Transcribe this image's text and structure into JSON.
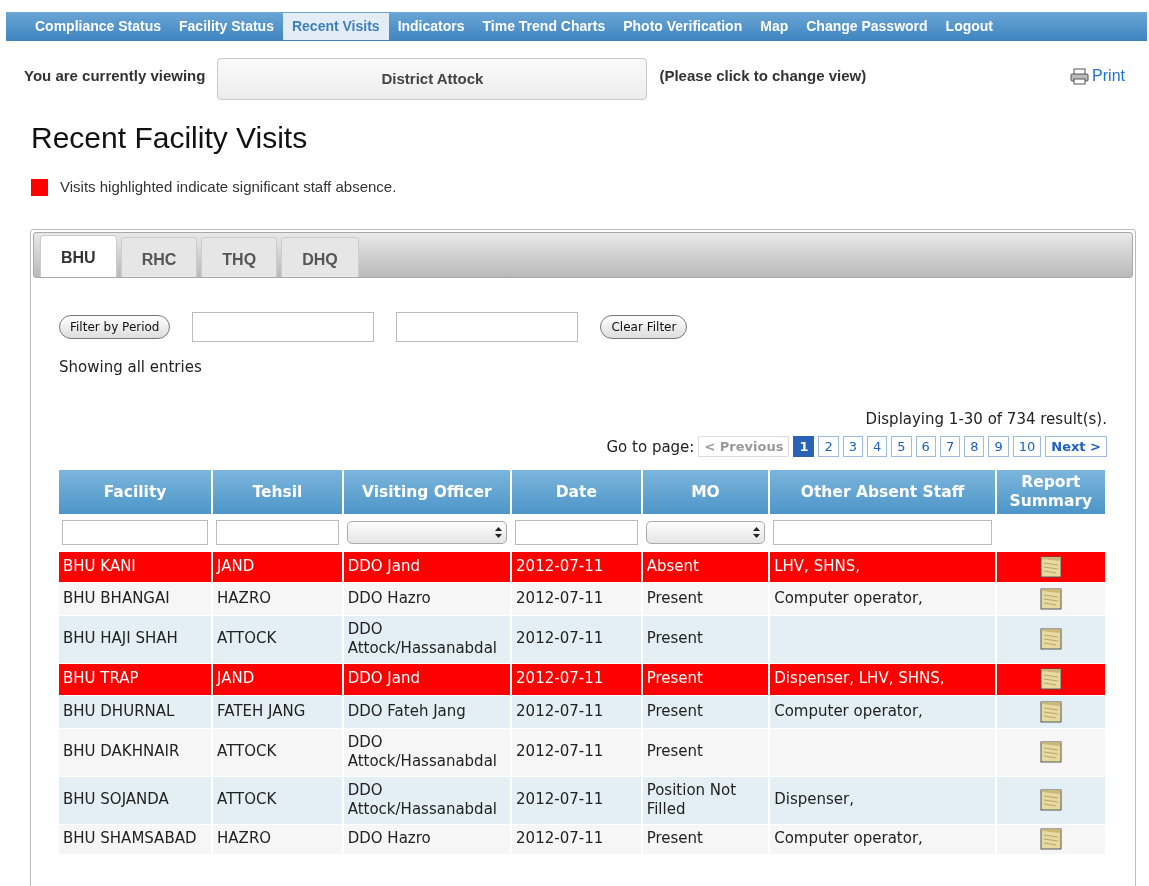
{
  "nav": [
    {
      "label": "Compliance Status",
      "selected": false
    },
    {
      "label": "Facility Status",
      "selected": false
    },
    {
      "label": "Recent Visits",
      "selected": true
    },
    {
      "label": "Indicators",
      "selected": false
    },
    {
      "label": "Time Trend Charts",
      "selected": false
    },
    {
      "label": "Photo Verification",
      "selected": false
    },
    {
      "label": "Map",
      "selected": false
    },
    {
      "label": "Change Password",
      "selected": false
    },
    {
      "label": "Logout",
      "selected": false
    }
  ],
  "viewing": {
    "label": "You are currently viewing",
    "value": "District Attock",
    "hint": "(Please click to change view)",
    "print": "Print"
  },
  "heading": "Recent Facility Visits",
  "legend": {
    "color": "#ff0000",
    "text": "Visits highlighted indicate significant staff absence."
  },
  "tabs": [
    {
      "label": "BHU",
      "selected": true
    },
    {
      "label": "RHC",
      "selected": false
    },
    {
      "label": "THQ",
      "selected": false
    },
    {
      "label": "DHQ",
      "selected": false
    }
  ],
  "filter": {
    "button": "Filter by Period",
    "clear": "Clear Filter",
    "status": "Showing all entries"
  },
  "results": "Displaying 1-30 of 734 result(s).",
  "pagination": {
    "label": "Go to page:",
    "previous": {
      "label": "< Previous",
      "disabled": true
    },
    "pages": [
      {
        "label": "1",
        "selected": true
      },
      {
        "label": "2",
        "selected": false
      },
      {
        "label": "3",
        "selected": false
      },
      {
        "label": "4",
        "selected": false
      },
      {
        "label": "5",
        "selected": false
      },
      {
        "label": "6",
        "selected": false
      },
      {
        "label": "7",
        "selected": false
      },
      {
        "label": "8",
        "selected": false
      },
      {
        "label": "9",
        "selected": false
      },
      {
        "label": "10",
        "selected": false
      }
    ],
    "next": {
      "label": "Next >",
      "disabled": false
    }
  },
  "table": {
    "columns": [
      {
        "label": "Facility",
        "kind": "text"
      },
      {
        "label": "Tehsil",
        "kind": "text"
      },
      {
        "label": "Visiting Officer",
        "kind": "select"
      },
      {
        "label": "Date",
        "kind": "text"
      },
      {
        "label": "MO",
        "kind": "select"
      },
      {
        "label": "Other Absent Staff",
        "kind": "text"
      },
      {
        "label": "Report Summary",
        "kind": "icon"
      }
    ],
    "rows": [
      {
        "highlighted": true,
        "cells": [
          "BHU KANI",
          "JAND",
          "DDO Jand",
          "2012-07-11",
          "Absent",
          "LHV, SHNS,"
        ]
      },
      {
        "highlighted": false,
        "cells": [
          "BHU BHANGAI",
          "HAZRO",
          "DDO Hazro",
          "2012-07-11",
          "Present",
          "Computer operator,"
        ]
      },
      {
        "highlighted": false,
        "cells": [
          "BHU HAJI SHAH",
          "ATTOCK",
          "DDO Attock/Hassanabdal",
          "2012-07-11",
          "Present",
          ""
        ]
      },
      {
        "highlighted": true,
        "cells": [
          "BHU TRAP",
          "JAND",
          "DDO Jand",
          "2012-07-11",
          "Present",
          "Dispenser, LHV, SHNS,"
        ]
      },
      {
        "highlighted": false,
        "cells": [
          "BHU DHURNAL",
          "FATEH JANG",
          "DDO Fateh Jang",
          "2012-07-11",
          "Present",
          "Computer operator,"
        ]
      },
      {
        "highlighted": false,
        "cells": [
          "BHU DAKHNAIR",
          "ATTOCK",
          "DDO Attock/Hassanabdal",
          "2012-07-11",
          "Present",
          ""
        ]
      },
      {
        "highlighted": false,
        "cells": [
          "BHU SOJANDA",
          "ATTOCK",
          "DDO Attock/Hassanabdal",
          "2012-07-11",
          "Position Not Filled",
          "Dispenser,"
        ]
      },
      {
        "highlighted": false,
        "cells": [
          "BHU SHAMSABAD",
          "HAZRO",
          "DDO Hazro",
          "2012-07-11",
          "Present",
          "Computer operator,"
        ]
      }
    ]
  }
}
